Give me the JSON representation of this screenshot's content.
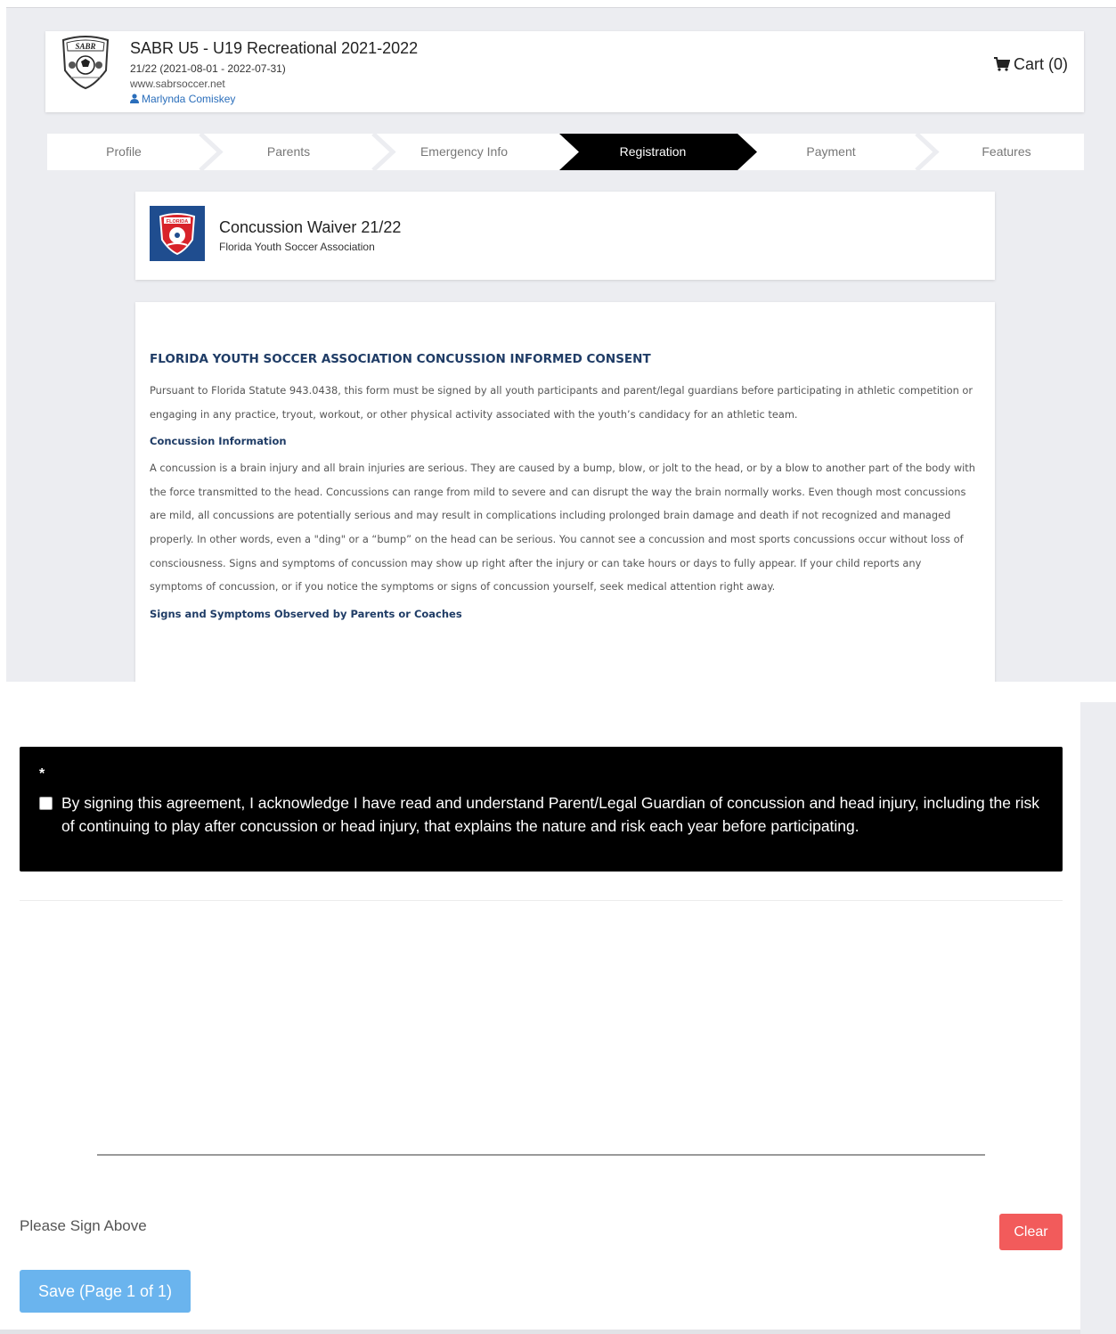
{
  "header": {
    "title": "SABR U5 - U19 Recreational 2021-2022",
    "season": "21/22 (2021-08-01 - 2022-07-31)",
    "website": "www.sabrsoccer.net",
    "user": "Marlynda Comiskey",
    "cart_label": "Cart (0)",
    "logo_icon": "sabr-logo"
  },
  "steps": [
    {
      "label": "Profile",
      "active": false
    },
    {
      "label": "Parents",
      "active": false
    },
    {
      "label": "Emergency Info",
      "active": false
    },
    {
      "label": "Registration",
      "active": true
    },
    {
      "label": "Payment",
      "active": false
    },
    {
      "label": "Features",
      "active": false
    }
  ],
  "waiver": {
    "title": "Concussion Waiver 21/22",
    "organization": "Florida Youth Soccer Association",
    "logo_icon": "fysa-logo"
  },
  "document": {
    "heading": "FLORIDA YOUTH SOCCER ASSOCIATION CONCUSSION INFORMED CONSENT",
    "intro": "Pursuant to Florida Statute 943.0438, this form must be signed by all youth participants and parent/legal guardians before participating in athletic competition or engaging in any practice, tryout, workout, or other physical activity associated with the youth’s candidacy for an athletic team.",
    "section1_title": "Concussion Information",
    "section1_text": "A concussion is a brain injury and all brain injuries are serious. They are caused by a bump, blow, or jolt to the head, or by a blow to another part of the body with the force transmitted to the head. Concussions can range from mild to severe and can disrupt the way the brain normally works. Even though most concussions are mild, all concussions are potentially serious and may result in complications including prolonged brain damage and death if not recognized and managed properly. In other words, even a \"ding\" or a “bump” on the head can be serious. You cannot see a concussion and most sports concussions occur without loss of consciousness. Signs and symptoms of concussion may show up right after the injury or can take hours or days to fully appear. If your child reports any symptoms of concussion, or if you notice the symptoms or signs of concussion yourself, seek medical attention right away.",
    "section2_title": "Signs and Symptoms Observed by Parents or Coaches"
  },
  "agreement": {
    "required_marker": "*",
    "checked": false,
    "text": "By signing this agreement, I acknowledge I have read and understand Parent/Legal Guardian of concussion and head injury, including the risk of continuing to play after concussion or head injury, that explains the nature and risk each year before participating."
  },
  "signature": {
    "prompt": "Please Sign Above",
    "clear_label": "Clear",
    "save_label": "Save (Page 1 of 1)"
  },
  "colors": {
    "page_bg": "#ecedf1",
    "active_step": "#000000",
    "heading_blue": "#1f3c66",
    "link_blue": "#2a6ebb",
    "clear_red": "#f25b5b",
    "save_blue": "#6ab4ee"
  }
}
